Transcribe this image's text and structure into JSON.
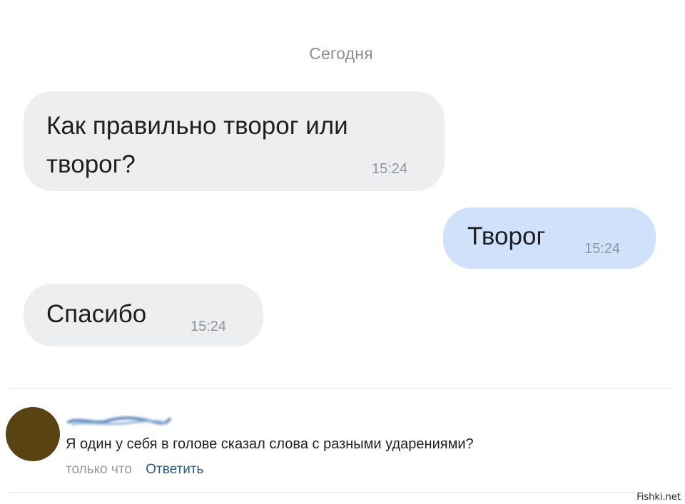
{
  "chat": {
    "date_separator": "Сегодня",
    "messages": [
      {
        "direction": "incoming",
        "line1": "Как правильно творог или",
        "line2": "творог?",
        "time": "15:24"
      },
      {
        "direction": "outgoing",
        "text": "Творог",
        "time": "15:24"
      },
      {
        "direction": "incoming",
        "text": "Спасибо",
        "time": "15:24"
      }
    ]
  },
  "comment": {
    "author_name": "(blurred)",
    "text": "Я один у себя в голове сказал слова с разными ударениями?",
    "time": "только что",
    "reply_label": "Ответить",
    "avatar_color": "#5a4312"
  },
  "watermark": "Fishki.net",
  "colors": {
    "incoming_bubble": "#edeef0",
    "outgoing_bubble": "#cfe1fb",
    "link": "#2a5885"
  }
}
